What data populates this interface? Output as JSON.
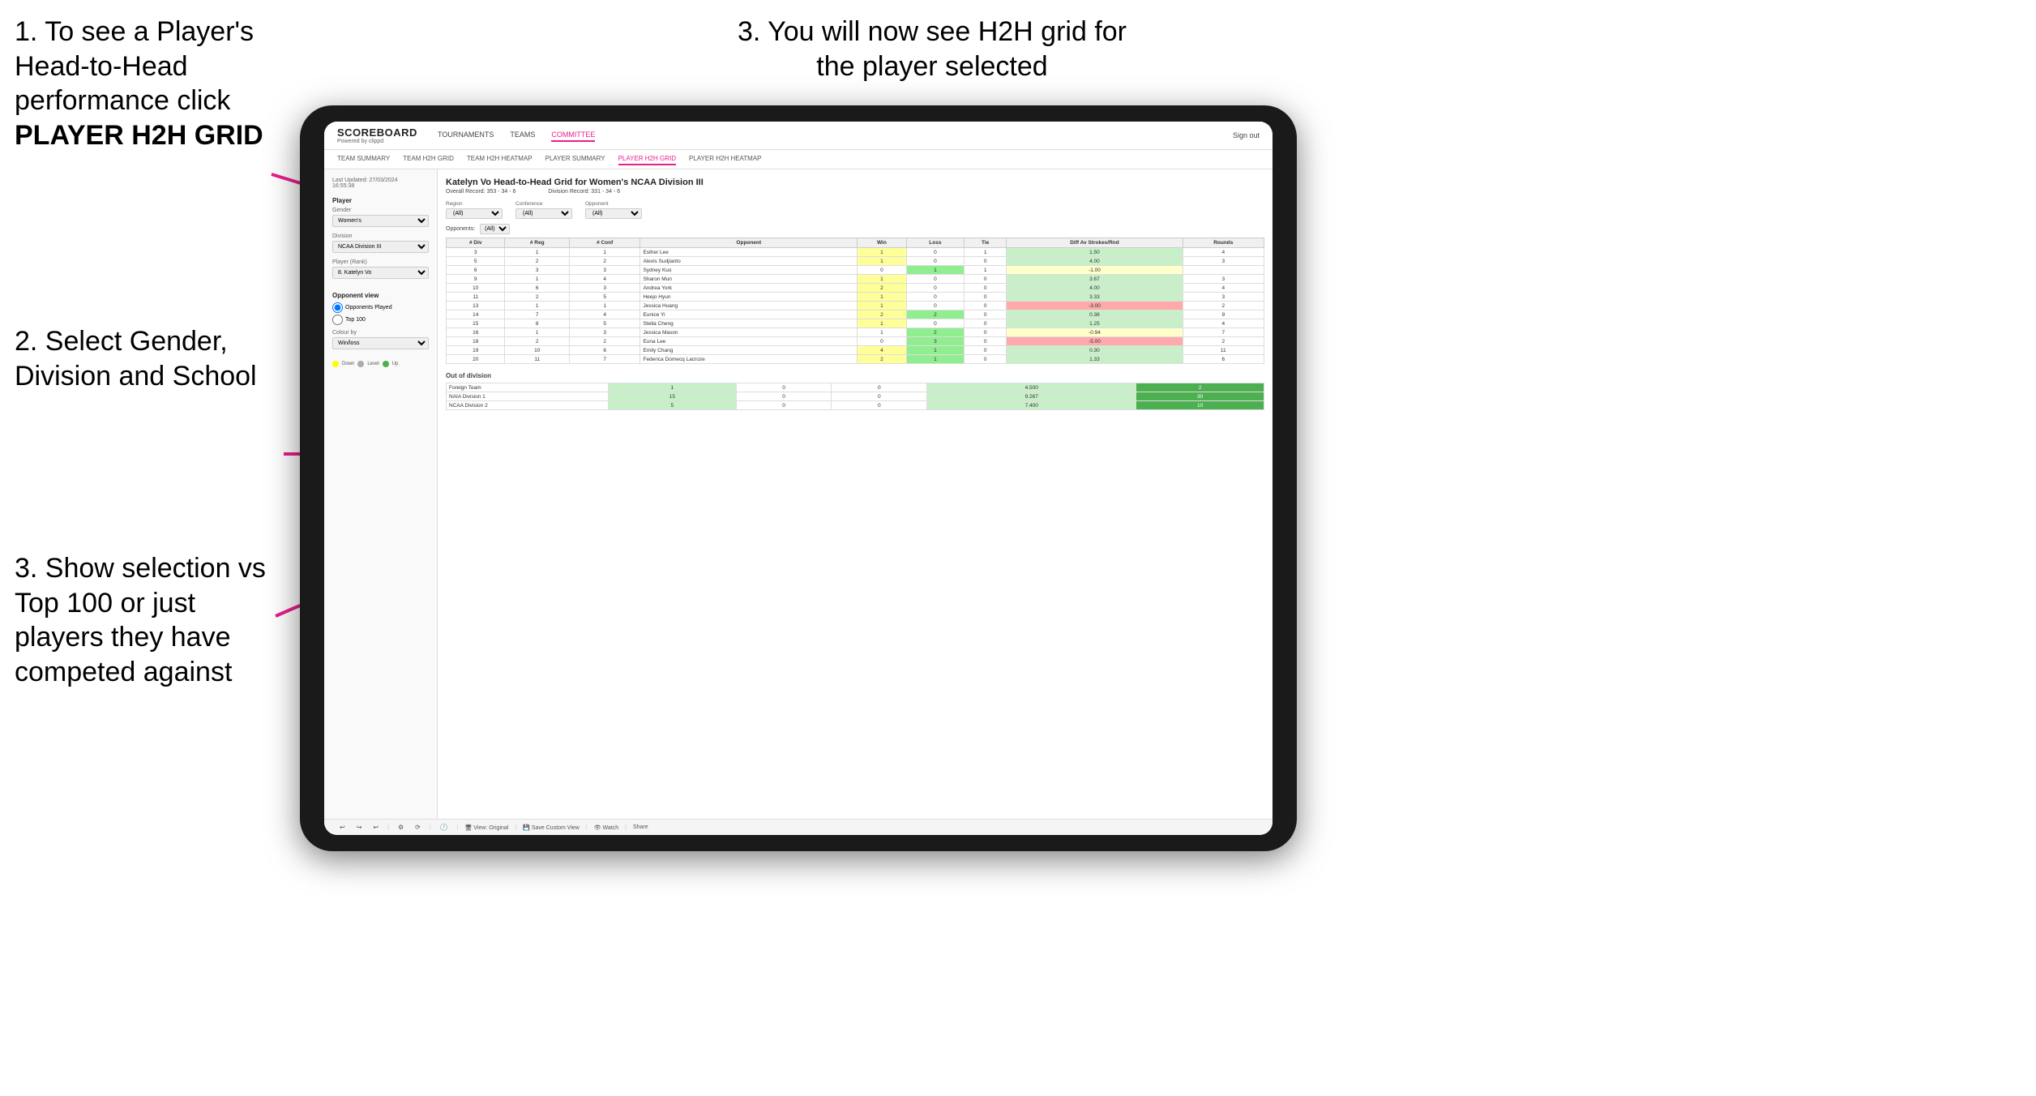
{
  "instructions": {
    "step1": "1. To see a Player's Head-to-Head performance click",
    "step1_bold": "PLAYER H2H GRID",
    "step2": "2. Select Gender, Division and School",
    "step3_left": "3. Show selection vs Top 100 or just players they have competed against",
    "step3_right": "3. You will now see H2H grid for the player selected"
  },
  "nav": {
    "logo": "SCOREBOARD",
    "logo_sub": "Powered by clippd",
    "items": [
      "TOURNAMENTS",
      "TEAMS",
      "COMMITTEE"
    ],
    "active": "COMMITTEE",
    "sign_out": "Sign out"
  },
  "sub_nav": {
    "items": [
      "TEAM SUMMARY",
      "TEAM H2H GRID",
      "TEAM H2H HEATMAP",
      "PLAYER SUMMARY",
      "PLAYER H2H GRID",
      "PLAYER H2H HEATMAP"
    ],
    "active": "PLAYER H2H GRID"
  },
  "left_panel": {
    "last_updated": "Last Updated: 27/03/2024",
    "last_updated_time": "16:55:38",
    "player_label": "Player",
    "gender_label": "Gender",
    "gender_value": "Women's",
    "division_label": "Division",
    "division_value": "NCAA Division III",
    "player_rank_label": "Player (Rank)",
    "player_rank_value": "8. Katelyn Vo",
    "opponent_view_label": "Opponent view",
    "opponents_played": "Opponents Played",
    "top_100": "Top 100",
    "colour_by_label": "Colour by",
    "colour_by_value": "Win/loss",
    "legend_down": "Down",
    "legend_level": "Level",
    "legend_up": "Up"
  },
  "grid": {
    "title": "Katelyn Vo Head-to-Head Grid for Women's NCAA Division III",
    "overall_record": "Overall Record: 353 - 34 - 6",
    "division_record": "Division Record: 331 - 34 - 6",
    "region_label": "Region",
    "conference_label": "Conference",
    "opponent_label": "Opponent",
    "opponents_label": "Opponents:",
    "region_filter": "(All)",
    "conference_filter": "(All)",
    "opponent_filter": "(All)",
    "columns": [
      "# Div",
      "# Reg",
      "# Conf",
      "Opponent",
      "Win",
      "Loss",
      "Tie",
      "Diff Av Strokes/Rnd",
      "Rounds"
    ],
    "rows": [
      {
        "div": 3,
        "reg": 1,
        "conf": 1,
        "opponent": "Esther Lee",
        "win": 1,
        "loss": 0,
        "tie": 1,
        "diff": 1.5,
        "rounds": 4,
        "win_color": "yellow",
        "loss_color": "green",
        "tie_color": "green"
      },
      {
        "div": 5,
        "reg": 2,
        "conf": 2,
        "opponent": "Alexis Sudjianto",
        "win": 1,
        "loss": 0,
        "tie": 0,
        "diff": 4.0,
        "rounds": 3,
        "win_color": "yellow"
      },
      {
        "div": 6,
        "reg": 3,
        "conf": 3,
        "opponent": "Sydney Kuo",
        "win": 0,
        "loss": 1,
        "tie": 1,
        "diff": -1.0,
        "rounds": "",
        "win_color": "green"
      },
      {
        "div": 9,
        "reg": 1,
        "conf": 4,
        "opponent": "Sharon Mun",
        "win": 1,
        "loss": 0,
        "tie": 0,
        "diff": 3.67,
        "rounds": 3,
        "win_color": "yellow"
      },
      {
        "div": 10,
        "reg": 6,
        "conf": 3,
        "opponent": "Andrea York",
        "win": 2,
        "loss": 0,
        "tie": 0,
        "diff": 4.0,
        "rounds": 4,
        "win_color": "yellow"
      },
      {
        "div": 11,
        "reg": 2,
        "conf": 5,
        "opponent": "Heejo Hyun",
        "win": 1,
        "loss": 0,
        "tie": 0,
        "diff": 3.33,
        "rounds": 3,
        "win_color": "yellow"
      },
      {
        "div": 13,
        "reg": 1,
        "conf": 1,
        "opponent": "Jessica Huang",
        "win": 1,
        "loss": 0,
        "tie": 0,
        "diff": -3.0,
        "rounds": 2,
        "win_color": "yellow"
      },
      {
        "div": 14,
        "reg": 7,
        "conf": 4,
        "opponent": "Eunice Yi",
        "win": 2,
        "loss": 2,
        "tie": 0,
        "diff": 0.38,
        "rounds": 9,
        "win_color": "yellow"
      },
      {
        "div": 15,
        "reg": 8,
        "conf": 5,
        "opponent": "Stella Cheng",
        "win": 1,
        "loss": 0,
        "tie": 0,
        "diff": 1.25,
        "rounds": 4,
        "win_color": "yellow"
      },
      {
        "div": 16,
        "reg": 1,
        "conf": 3,
        "opponent": "Jessica Mason",
        "win": 1,
        "loss": 2,
        "tie": 0,
        "diff": -0.94,
        "rounds": 7,
        "win_color": "green"
      },
      {
        "div": 18,
        "reg": 2,
        "conf": 2,
        "opponent": "Euna Lee",
        "win": 0,
        "loss": 3,
        "tie": 0,
        "diff": -5.0,
        "rounds": 2,
        "win_color": "red"
      },
      {
        "div": 19,
        "reg": 10,
        "conf": 6,
        "opponent": "Emily Chang",
        "win": 4,
        "loss": 1,
        "tie": 0,
        "diff": 0.3,
        "rounds": 11,
        "win_color": "yellow"
      },
      {
        "div": 20,
        "reg": 11,
        "conf": 7,
        "opponent": "Federica Domecq Lacroze",
        "win": 2,
        "loss": 1,
        "tie": 0,
        "diff": 1.33,
        "rounds": 6,
        "win_color": "yellow"
      }
    ],
    "out_of_division_title": "Out of division",
    "out_of_division_rows": [
      {
        "opponent": "Foreign Team",
        "win": 1,
        "loss": 0,
        "tie": 0,
        "diff": 4.5,
        "rounds": 2
      },
      {
        "opponent": "NAIA Division 1",
        "win": 15,
        "loss": 0,
        "tie": 0,
        "diff": 9.267,
        "rounds": 30
      },
      {
        "opponent": "NCAA Division 2",
        "win": 5,
        "loss": 0,
        "tie": 0,
        "diff": 7.4,
        "rounds": 10
      }
    ]
  },
  "toolbar": {
    "view_original": "View: Original",
    "save_custom": "Save Custom View",
    "watch": "Watch",
    "share": "Share"
  }
}
